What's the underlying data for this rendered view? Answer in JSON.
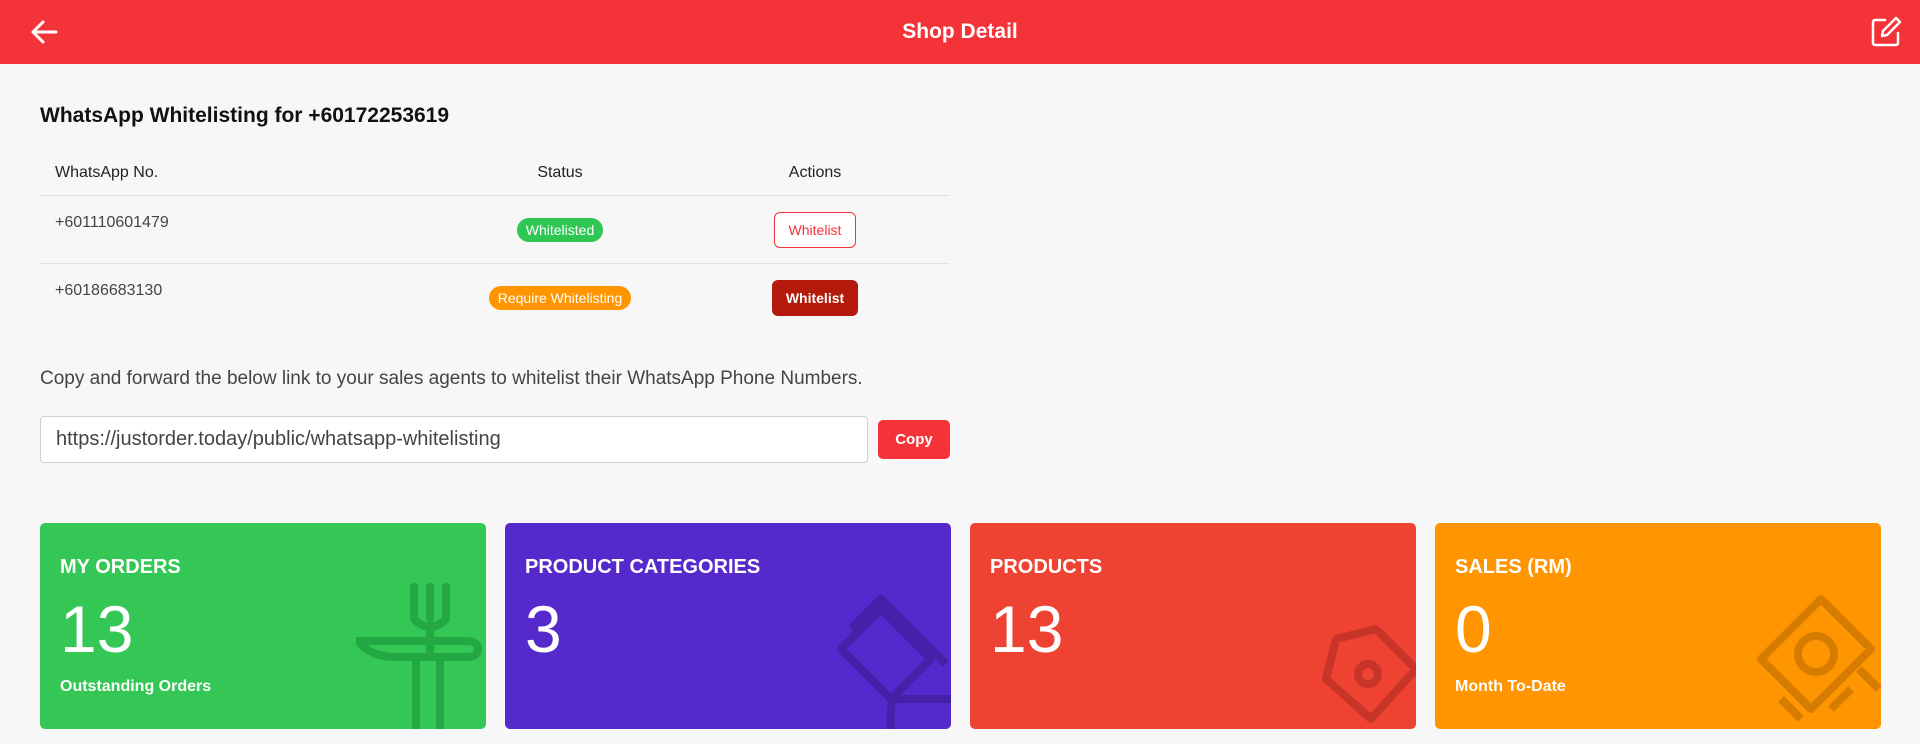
{
  "header": {
    "title": "Shop Detail",
    "back_icon": "arrow-left-icon",
    "edit_icon": "edit-icon",
    "color": "#f43339"
  },
  "whitelist": {
    "heading": "WhatsApp Whitelisting for +60172253619",
    "columns": [
      "WhatsApp No.",
      "Status",
      "Actions"
    ],
    "rows": [
      {
        "number": "+601110601479",
        "status": "Whitelisted",
        "status_color": "#2fc753",
        "action": "Whitelist"
      },
      {
        "number": "+60186683130",
        "status": "Require Whitelisting",
        "status_color": "#ff9500",
        "action": "Whitelist"
      }
    ]
  },
  "share": {
    "instruction": "Copy and forward the below link to your sales agents to whitelist their WhatsApp Phone Numbers.",
    "link": "https://justorder.today/public/whatsapp-whitelisting",
    "copy_label": "Copy"
  },
  "cards": [
    {
      "label": "MY ORDERS",
      "value": "13",
      "sub": "Outstanding Orders",
      "color": "#34c755",
      "icon": "utensils-icon"
    },
    {
      "label": "PRODUCT CATEGORIES",
      "value": "3",
      "sub": "",
      "color": "#5629cc",
      "icon": "layers-icon"
    },
    {
      "label": "PRODUCTS",
      "value": "13",
      "sub": "",
      "color": "#ee4232",
      "icon": "tag-icon"
    },
    {
      "label": "SALES (RM)",
      "value": "0",
      "sub": "Month To-Date",
      "color": "#ff9500",
      "icon": "money-icon"
    }
  ]
}
